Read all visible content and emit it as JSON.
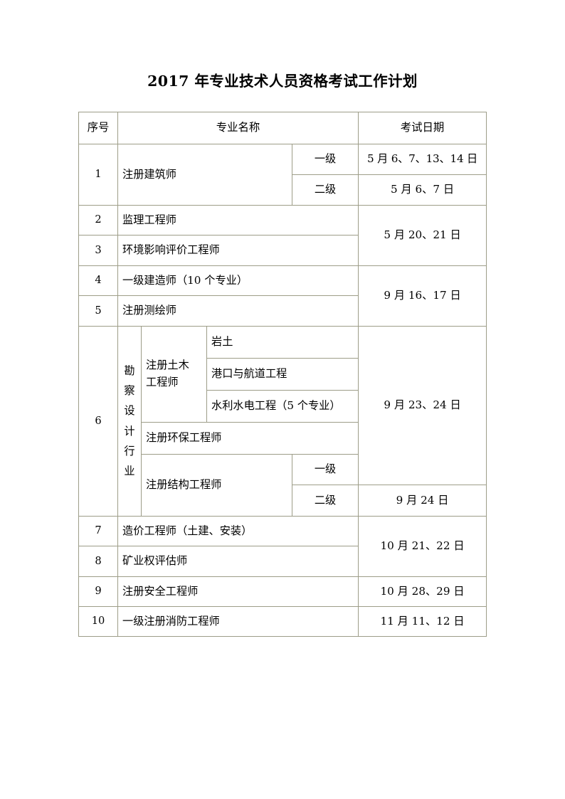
{
  "document": {
    "title": "2017 年专业技术人员资格考试工作计划"
  },
  "table": {
    "headers": {
      "seq": "序号",
      "name": "专业名称",
      "date": "考试日期"
    },
    "rows": [
      {
        "seq": "1",
        "name": "注册建筑师",
        "levels": [
          {
            "level": "一级",
            "date": "5 月 6、7、13、14 日"
          },
          {
            "level": "二级",
            "date": "5 月 6、7 日"
          }
        ]
      },
      {
        "seq": "2",
        "name": "监理工程师",
        "date": "5 月 20、21 日"
      },
      {
        "seq": "3",
        "name": "环境影响评价工程师"
      },
      {
        "seq": "4",
        "name": "一级建造师（10 个专业）",
        "date": "9 月 16、17 日"
      },
      {
        "seq": "5",
        "name": "注册测绘师"
      },
      {
        "seq": "6",
        "industry": "勘察设计行业",
        "industry_chars": [
          "勘",
          "察",
          "设",
          "计",
          "行",
          "业"
        ],
        "date": "9 月 23、24 日",
        "date_secondary": "9 月 24 日",
        "groups": [
          {
            "name": "注册土木工程师",
            "name_line1": "注册土木",
            "name_line2": "工程师",
            "specialties": [
              "岩土",
              "港口与航道工程",
              "水利水电工程（5 个专业）"
            ]
          },
          {
            "name": "注册环保工程师"
          },
          {
            "name": "注册结构工程师",
            "levels": [
              "一级",
              "二级"
            ]
          }
        ]
      },
      {
        "seq": "7",
        "name": "造价工程师（土建、安装）",
        "date": "10 月 21、22 日"
      },
      {
        "seq": "8",
        "name": "矿业权评估师"
      },
      {
        "seq": "9",
        "name": "注册安全工程师",
        "date": "10 月 28、29 日"
      },
      {
        "seq": "10",
        "name": "一级注册消防工程师",
        "date": "11 月 11、12 日"
      }
    ]
  }
}
